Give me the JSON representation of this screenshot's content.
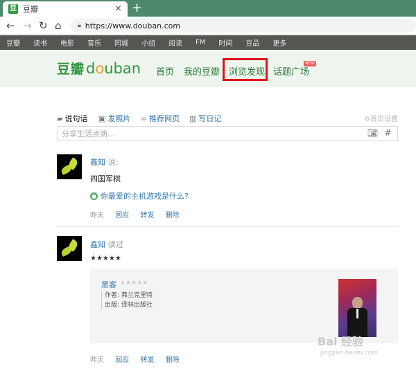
{
  "browser": {
    "tab_title": "豆瓣",
    "tab_icon": "douban-favicon",
    "tab_close": "×",
    "new_tab": "+",
    "url": "https://www.douban.com",
    "colors": {
      "tab_bar": "#4d8a6b"
    }
  },
  "global_nav": {
    "items": [
      "豆瓣",
      "读书",
      "电影",
      "音乐",
      "同城",
      "小组",
      "阅读",
      "FM",
      "时间",
      "豆品",
      "更多"
    ]
  },
  "header": {
    "logo_zh": "豆瓣",
    "logo_en_prefix": "d",
    "logo_en_o": "o",
    "logo_en_suffix": "uban",
    "nav": [
      "首页",
      "我的豆瓣",
      "浏览发现",
      "话题广场"
    ],
    "new_badge": "NEW",
    "highlighted_item": "浏览发现",
    "colors": {
      "brand_green": "#2e963d",
      "highlight": "#e0121b",
      "header_bg": "#eef4ee"
    }
  },
  "composer": {
    "tabs": [
      "说句话",
      "发照片",
      "推荐网页",
      "写日记"
    ],
    "active_tab": "说句话",
    "settings": "首页设置",
    "placeholder": "分享生活点滴..."
  },
  "feed": [
    {
      "user": "鑫知",
      "action": "说:",
      "text": "四国军棋",
      "topic": "你最爱的主机游戏是什么?",
      "actions": [
        "昨天",
        "回应",
        "转发",
        "删除"
      ]
    },
    {
      "user": "鑫知",
      "action": "读过",
      "rating_stars": "★★★★★",
      "book": {
        "title": "黑客",
        "stars": "★★★★★",
        "author": "作者: 弗兰克里特",
        "publisher": "出版: 译林出版社"
      },
      "actions": [
        "昨天",
        "回应",
        "转发",
        "删除"
      ]
    }
  ],
  "watermark": {
    "text": "Bai 经验",
    "sub": "jingyan.baidu.com"
  }
}
